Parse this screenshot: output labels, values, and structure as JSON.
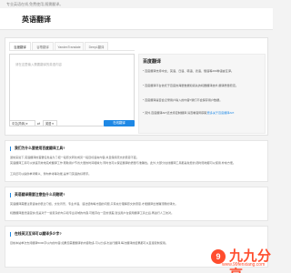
{
  "page": {
    "top_note": "专业英语在线,免费使用,随需翻译。"
  },
  "header": {
    "brand": "英语翻译"
  },
  "tabs": [
    {
      "label": "百度翻译"
    },
    {
      "label": "谷歌翻译"
    },
    {
      "label": "YandexTranslate"
    },
    {
      "label": "DeepL翻译"
    }
  ],
  "translator": {
    "placeholder": "请在这里输入需要翻译的英语内容",
    "source_lang": "中文(简体)",
    "swap_icon": "swap-arrows-icon",
    "target_lang": "英语",
    "translate_button": "在线翻译"
  },
  "info": {
    "title": "百度翻译",
    "lines": [
      "* 百度翻译支持中文、英语、日语、韩语、德语、俄语等200种语言互译。",
      "* 百度翻译平台依托于百度的海量数据和领先的机器翻译技术,翻译质量稳定。",
      "* 百度翻译是否会记录用户输入的内容?我们不会保存用户数据。",
      "* 另外,百度翻译API还支持定制翻译,请查看官网获取"
    ],
    "link_text": "更多关于百度翻译API"
  },
  "sections": [
    {
      "title": "我们为什么要使用百度翻译工具?",
      "paragraphs": [
        "通常来说下,英语翻译的首要任务是为了把一段原文转化成另一段目标语言内容,并且保持原文的意思不变。",
        "英语翻译工具可以快速高效地完成翻译工作,帮助用户节省大量的时间和精力,同时也可以保证翻译的质量与准确性。此外,大部分在线翻译工具都是免费的,随时随地都可以使用,非常方便。",
        "工具还可以提供单词释义、例句参考等功能,是学习英语的好帮手。"
      ]
    },
    {
      "title": "英语翻译需要注意些什么问题呢?",
      "paragraphs": [
        "英语翻译需要注意语言的表达习惯、文化背景、专业术语、语法结构等方面的问题,只有充分理解原文的意思,才能翻译出准确流畅的译文。",
        "机器翻译虽然速度快,但是对于一些复杂的句子和专业领域的内容,可能存在一定的误差,建议用户在使用翻译工具之后,再进行人工校对。"
      ]
    },
    {
      "title": "在线英汉互译可以翻译多少字?",
      "paragraphs": [
        "目前本站单次支持翻译5000字以内的内容,如果您需要翻译的内容较多,可以分多次进行翻译,每次翻译的结果都可以直接复制使用。"
      ]
    }
  ],
  "watermark": {
    "big": "九九分享",
    "small": "www.99fenxiang.com",
    "mark": "9"
  }
}
